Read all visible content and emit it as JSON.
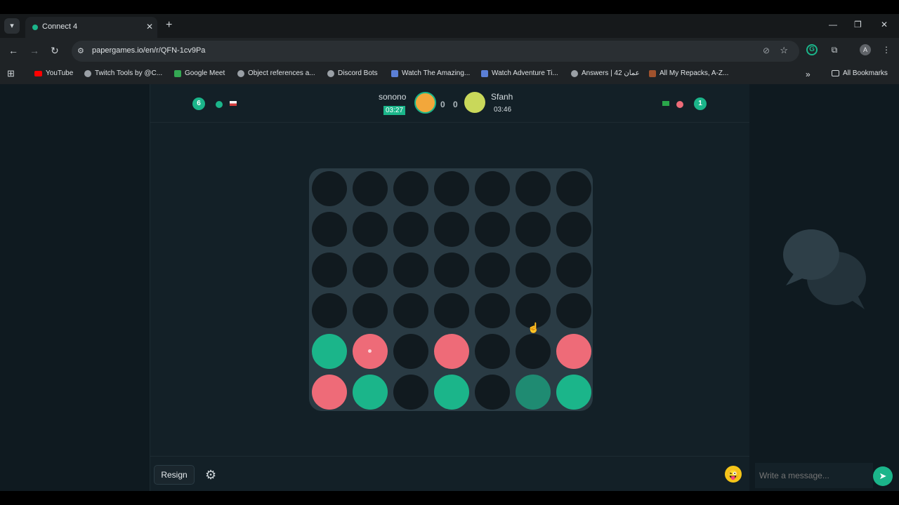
{
  "browser": {
    "tab_title": "Connect 4",
    "url": "papergames.io/en/r/QFN-1cv9Pa",
    "bookmarks": [
      {
        "label": "YouTube",
        "icon": "youtube-icon"
      },
      {
        "label": "Twitch Tools by @C...",
        "icon": "globe-icon"
      },
      {
        "label": "Google Meet",
        "icon": "google-meet-icon"
      },
      {
        "label": "Object references a...",
        "icon": "globe-icon"
      },
      {
        "label": "Discord Bots",
        "icon": "globe-icon"
      },
      {
        "label": "Watch The Amazing...",
        "icon": "image-icon"
      },
      {
        "label": "Watch Adventure Ti...",
        "icon": "image-icon"
      },
      {
        "label": "Answers | عمان 42",
        "icon": "globe-icon"
      },
      {
        "label": "All My Repacks, A-Z...",
        "icon": "picture-icon"
      }
    ],
    "all_bookmarks": "All Bookmarks"
  },
  "game": {
    "left_score": "6",
    "right_score": "1",
    "player1": {
      "name": "sonono",
      "timer": "03:27"
    },
    "player2": {
      "name": "Sfanh",
      "timer": "03:46"
    },
    "middle_score": [
      "0",
      "0"
    ],
    "board": [
      [
        "empty",
        "empty",
        "empty",
        "empty",
        "empty",
        "empty",
        "empty"
      ],
      [
        "empty",
        "empty",
        "empty",
        "empty",
        "empty",
        "empty",
        "empty"
      ],
      [
        "empty",
        "empty",
        "empty",
        "empty",
        "empty",
        "empty",
        "empty"
      ],
      [
        "empty",
        "empty",
        "empty",
        "empty",
        "empty",
        "empty",
        "empty"
      ],
      [
        "teal",
        "red",
        "empty",
        "red",
        "empty",
        "empty",
        "red"
      ],
      [
        "red",
        "teal",
        "empty",
        "teal",
        "empty",
        "teal-dim",
        "teal"
      ]
    ],
    "last_move": {
      "row": 4,
      "col": 1
    },
    "colors": {
      "teal": "#1bb58a",
      "red": "#ee6b78",
      "board": "#2a3b44",
      "empty": "#111a1f"
    }
  },
  "footer": {
    "resign_label": "Resign"
  },
  "chat": {
    "placeholder": "Write a message..."
  }
}
